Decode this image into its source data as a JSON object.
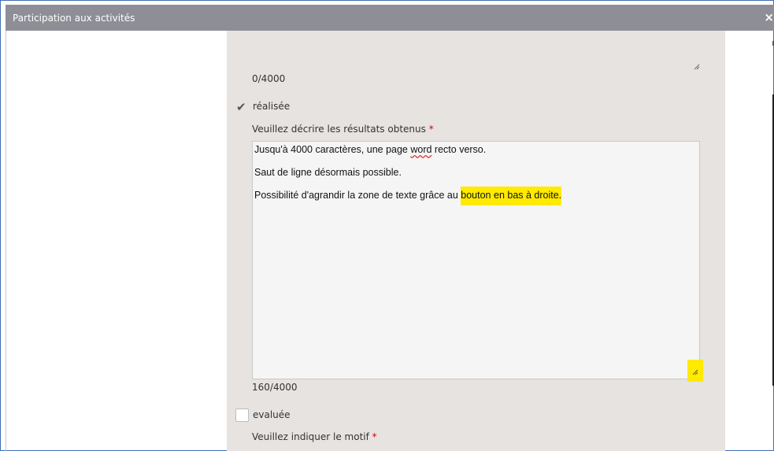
{
  "dialog": {
    "title": "Participation aux activités",
    "close_glyph": "×"
  },
  "form": {
    "top_counter": "0/4000",
    "realisee": {
      "label": "réalisée",
      "checked": true
    },
    "results": {
      "label": "Veuillez décrire les résultats obtenus",
      "required_mark": "*",
      "line1_pre": "Jusqu'à 4000 caractères, une page ",
      "line1_word": "word",
      "line1_post": " recto verso.",
      "line2": "Saut de ligne désormais possible.",
      "line3_pre": "Possibilité d'agrandir la zone de texte grâce au ",
      "line3_highlight": "bouton en bas à droite.",
      "counter": "160/4000"
    },
    "evaluee": {
      "label": "evaluée",
      "checked": false
    },
    "motif": {
      "label": "Veuillez indiquer le motif",
      "required_mark": "*"
    }
  },
  "colors": {
    "titlebar": "#8e8e96",
    "panel": "#e6e3e0",
    "highlight": "#ffea00",
    "required": "#d00000"
  }
}
